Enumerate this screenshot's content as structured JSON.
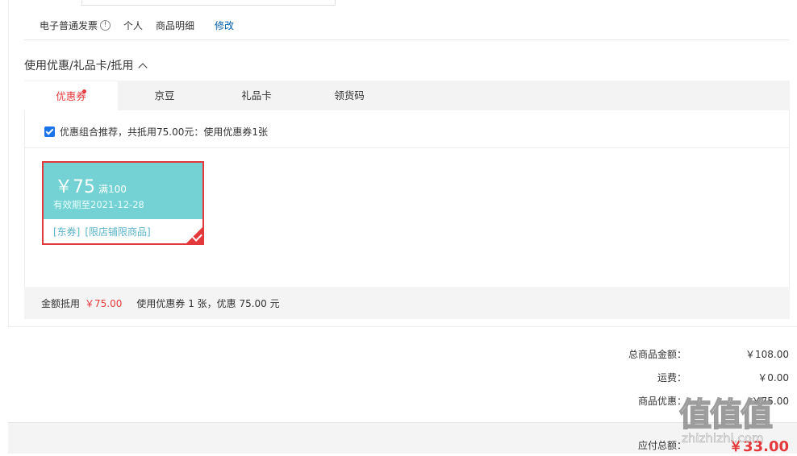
{
  "invoice": {
    "type": "电子普通发票",
    "info_icon": "info-circle-icon",
    "title": "个人",
    "content": "商品明细",
    "edit": "修改"
  },
  "discount_section": {
    "title": "使用优惠/礼品卡/抵用",
    "toggle_icon": "chevron-up-icon",
    "tabs": [
      {
        "label": "优惠券",
        "active": true,
        "badge": "red-dot"
      },
      {
        "label": "京豆"
      },
      {
        "label": "礼品卡"
      },
      {
        "label": "领货码"
      }
    ],
    "combo_recommend": "优惠组合推荐，共抵用75.00元：使用优惠券1张",
    "combo_checked": true,
    "coupon": {
      "currency": "￥",
      "amount": "75",
      "condition": "满100",
      "valid_until": "有效期至2021-12-28",
      "tag_1": "[东券]",
      "tag_2": "[限店铺限商品]",
      "selected": true
    },
    "summary": {
      "label": "金额抵用",
      "amount": "￥75.00",
      "detail": "使用优惠券 1 张，优惠 75.00 元"
    }
  },
  "totals": {
    "goods_label": "总商品金额：",
    "goods_value": "￥108.00",
    "shipping_label": "运费：",
    "shipping_value": "￥0.00",
    "discount_label": "商品优惠：",
    "discount_value": "-￥75.00",
    "payable_label": "应付总额：",
    "payable_value": "￥33.00"
  },
  "watermark": {
    "main": "值值值",
    "sub": "zhizhizhi.com"
  },
  "colors": {
    "accent_red": "#e4393c",
    "coupon_teal": "#74d2d4",
    "link_blue": "#005ea7"
  }
}
